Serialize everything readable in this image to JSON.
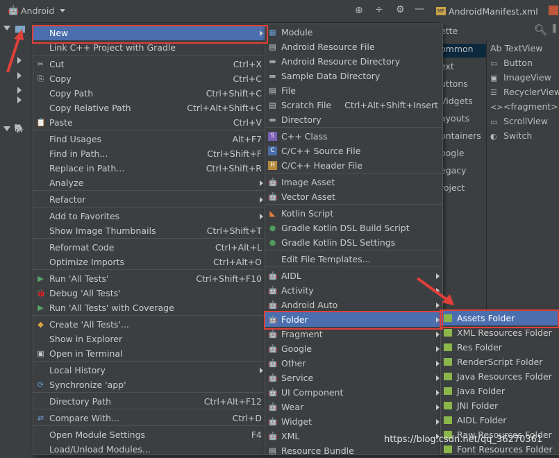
{
  "ide": {
    "project_view": "Android",
    "tab_manifest": "AndroidManifest.xml",
    "palette_title": "ette",
    "palette_categories": [
      "ommon",
      "ext",
      "uttons",
      "Vidgets",
      "ayouts",
      "ontainers",
      "oogle",
      "egacy",
      "roject"
    ],
    "palette_items": [
      "TextView",
      "Button",
      "ImageView",
      "RecyclerView",
      "<fragment>",
      "ScrollView",
      "Switch"
    ],
    "palette_textview_prefix": "Ab"
  },
  "context_menu": [
    {
      "label": "New",
      "selected": true,
      "submenu": true,
      "icon": ""
    },
    {
      "label": "Link C++ Project with Gradle"
    },
    {
      "sep": true
    },
    {
      "label": "Cut",
      "shortcut": "Ctrl+X",
      "icon": "✂"
    },
    {
      "label": "Copy",
      "shortcut": "Ctrl+C",
      "icon": "⎘"
    },
    {
      "label": "Copy Path",
      "shortcut": "Ctrl+Shift+C"
    },
    {
      "label": "Copy Relative Path",
      "shortcut": "Ctrl+Alt+Shift+C"
    },
    {
      "label": "Paste",
      "shortcut": "Ctrl+V",
      "icon": "📋"
    },
    {
      "sep": true
    },
    {
      "label": "Find Usages",
      "shortcut": "Alt+F7"
    },
    {
      "label": "Find in Path...",
      "shortcut": "Ctrl+Shift+F"
    },
    {
      "label": "Replace in Path...",
      "shortcut": "Ctrl+Shift+R"
    },
    {
      "label": "Analyze",
      "submenu": true
    },
    {
      "sep": true
    },
    {
      "label": "Refactor",
      "submenu": true
    },
    {
      "sep": true
    },
    {
      "label": "Add to Favorites",
      "submenu": true
    },
    {
      "label": "Show Image Thumbnails",
      "shortcut": "Ctrl+Shift+T"
    },
    {
      "sep": true
    },
    {
      "label": "Reformat Code",
      "shortcut": "Ctrl+Alt+L"
    },
    {
      "label": "Optimize Imports",
      "shortcut": "Ctrl+Alt+O"
    },
    {
      "sep": true
    },
    {
      "label": "Run 'All Tests'",
      "shortcut": "Ctrl+Shift+F10",
      "icon": "▶"
    },
    {
      "label": "Debug 'All Tests'",
      "icon": "🐞"
    },
    {
      "label": "Run 'All Tests' with Coverage",
      "icon": "▶"
    },
    {
      "sep": true
    },
    {
      "label": "Create 'All Tests'...",
      "icon": "◆"
    },
    {
      "label": "Show in Explorer"
    },
    {
      "label": "Open in Terminal",
      "icon": "▣"
    },
    {
      "sep": true
    },
    {
      "label": "Local History",
      "submenu": true
    },
    {
      "label": "Synchronize 'app'",
      "icon": "⟳"
    },
    {
      "sep": true
    },
    {
      "label": "Directory Path",
      "shortcut": "Ctrl+Alt+F12"
    },
    {
      "sep": true
    },
    {
      "label": "Compare With...",
      "shortcut": "Ctrl+D",
      "icon": "⇄"
    },
    {
      "sep": true
    },
    {
      "label": "Open Module Settings",
      "shortcut": "F4"
    },
    {
      "label": "Load/Unload Modules..."
    }
  ],
  "new_menu": [
    {
      "label": "Module",
      "icon": "▦"
    },
    {
      "label": "Android Resource File",
      "icon": "▤"
    },
    {
      "label": "Android Resource Directory",
      "icon": "▬"
    },
    {
      "label": "Sample Data Directory",
      "icon": "▬"
    },
    {
      "label": "File",
      "icon": "▤"
    },
    {
      "label": "Scratch File",
      "shortcut": "Ctrl+Alt+Shift+Insert",
      "icon": "▤"
    },
    {
      "label": "Directory",
      "icon": "▬"
    },
    {
      "sep": true
    },
    {
      "label": "C++ Class",
      "icon": "S"
    },
    {
      "label": "C/C++ Source File",
      "icon": "C"
    },
    {
      "label": "C/C++ Header File",
      "icon": "H"
    },
    {
      "sep": true
    },
    {
      "label": "Image Asset",
      "icon": "🤖"
    },
    {
      "label": "Vector Asset",
      "icon": "🤖"
    },
    {
      "sep": true
    },
    {
      "label": "Kotlin Script",
      "icon": "◣"
    },
    {
      "label": "Gradle Kotlin DSL Build Script",
      "icon": "●"
    },
    {
      "label": "Gradle Kotlin DSL Settings",
      "icon": "●"
    },
    {
      "sep": true
    },
    {
      "label": "Edit File Templates..."
    },
    {
      "sep": true
    },
    {
      "label": "AIDL",
      "submenu": true,
      "icon": "🤖"
    },
    {
      "label": "Activity",
      "submenu": true,
      "icon": "🤖"
    },
    {
      "label": "Android Auto",
      "submenu": true,
      "icon": "🤖"
    },
    {
      "label": "Folder",
      "submenu": true,
      "selected": true,
      "icon": "🤖"
    },
    {
      "label": "Fragment",
      "submenu": true,
      "icon": "🤖"
    },
    {
      "label": "Google",
      "submenu": true,
      "icon": "🤖"
    },
    {
      "label": "Other",
      "submenu": true,
      "icon": "🤖"
    },
    {
      "label": "Service",
      "submenu": true,
      "icon": "🤖"
    },
    {
      "label": "UI Component",
      "submenu": true,
      "icon": "🤖"
    },
    {
      "label": "Wear",
      "submenu": true,
      "icon": "🤖"
    },
    {
      "label": "Widget",
      "submenu": true,
      "icon": "🤖"
    },
    {
      "label": "XML",
      "submenu": true,
      "icon": "🤖"
    },
    {
      "label": "Resource Bundle",
      "icon": "▤"
    }
  ],
  "folder_menu": [
    {
      "label": "Assets Folder",
      "selected": true
    },
    {
      "label": "XML Resources Folder"
    },
    {
      "label": "Res Folder"
    },
    {
      "label": "RenderScript Folder"
    },
    {
      "label": "Java Resources Folder"
    },
    {
      "label": "Java Folder"
    },
    {
      "label": "JNI Folder"
    },
    {
      "label": "AIDL Folder"
    },
    {
      "label": "Raw Resources Folder"
    },
    {
      "label": "Font Resources Folder"
    }
  ],
  "watermark": "https://blog.csdn.net/qq_36270361",
  "colors": {
    "selection": "#4b6eaf",
    "highlight_box": "#e0403a",
    "android_green": "#9ec74c"
  }
}
